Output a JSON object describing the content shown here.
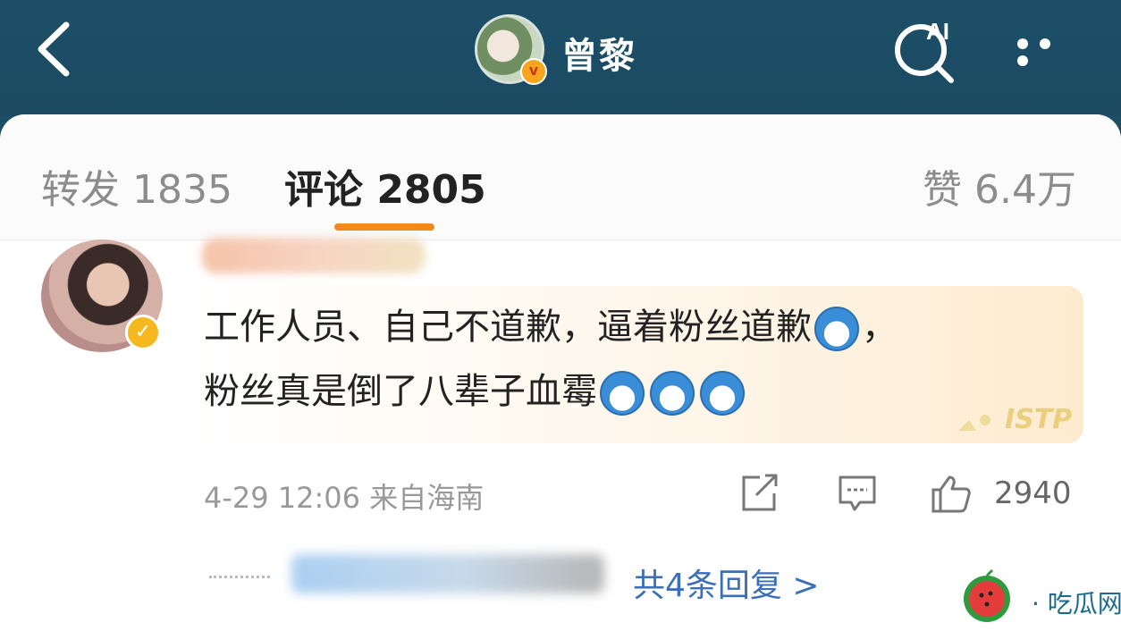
{
  "header": {
    "back_icon": "chevron-left-icon",
    "name": "曾黎",
    "ai_search_label": "AI",
    "more_icon": "more-dots-icon"
  },
  "tabs": {
    "repost": "转发 1835",
    "comment": "评论 2805",
    "like": "赞 6.4万",
    "active": "comment",
    "accent_color": "#f28a1b"
  },
  "comment": {
    "text_line1": "工作人员、自己不道歉，逼着粉丝道歉",
    "text_line1_end": "，",
    "text_line2": "粉丝真是倒了八辈子血霉",
    "timestamp": "4-29 12:06 来自海南",
    "like_count": "2940",
    "stamp_text": "ISTP",
    "verified_icon": "verified-badge-icon"
  },
  "replies": {
    "link_text": "共4条回复 >"
  },
  "watermark": {
    "text": "· 吃瓜网 ·"
  },
  "colors": {
    "topbar": "#1d4f68",
    "link": "#3b6fb6",
    "verified": "#f5b81f"
  }
}
